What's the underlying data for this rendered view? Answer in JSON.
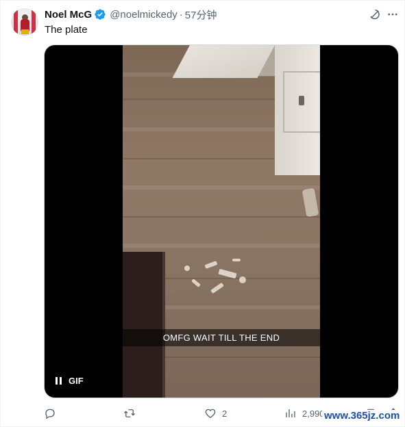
{
  "author": {
    "name": "Noel McG",
    "handle": "@noelmickedy",
    "separator": "·",
    "time": "57分钟",
    "verified": true
  },
  "tweet": {
    "text": "The plate"
  },
  "header_icons": [
    "grok-icon",
    "more-icon"
  ],
  "media": {
    "type": "GIF",
    "caption": "OMFG WAIT TILL THE END",
    "badge": "GIF",
    "state": "playing"
  },
  "actions": {
    "reply_count": "",
    "repost_count": "",
    "like_count": "2",
    "views_count": "2,990"
  },
  "watermark": "www.365jz.com",
  "colors": {
    "text_primary": "#0f1419",
    "text_secondary": "#536471",
    "verified_blue": "#1d9bf0",
    "media_bg": "#000000"
  }
}
